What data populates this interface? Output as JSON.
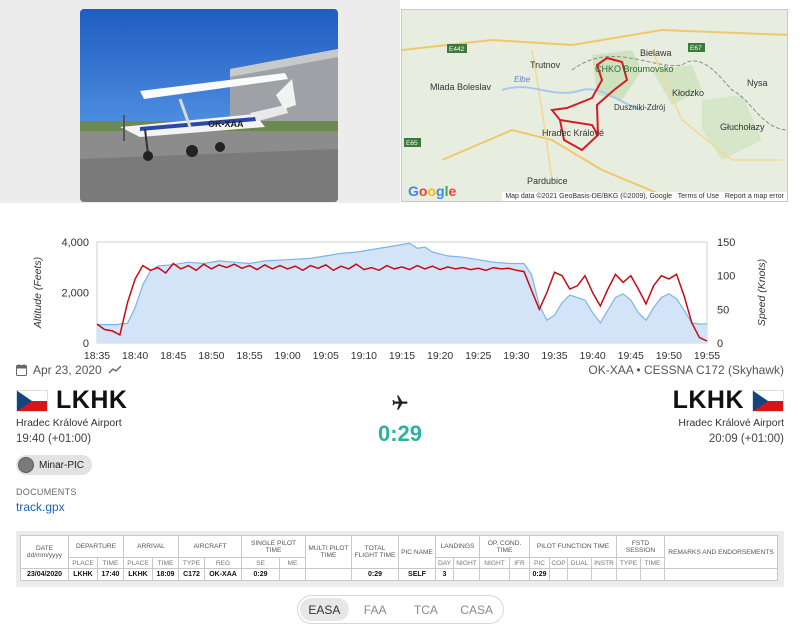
{
  "photo": {
    "registration_marking": "OK-XAA"
  },
  "map": {
    "places": [
      "Trutnov",
      "Mlada Boleslav",
      "Hradec Králové",
      "Pardubice",
      "Kłodzko",
      "Nysa",
      "Bielawa",
      "Głuchołazy",
      "Duszniki-Zdrój",
      "CHKO Broumovsko",
      "Elbe"
    ],
    "road_labels": [
      "E442",
      "E67",
      "E65"
    ],
    "attribution": "Map data ©2021 GeoBasis-DE/BKG (©2009), Google",
    "terms": "Terms of Use",
    "report": "Report a map error",
    "logo": "Google"
  },
  "chart_data": {
    "type": "line",
    "ylabel_left": "Altitude (Feets)",
    "ylabel_right": "Speed (Knots)",
    "y_left_ticks": [
      "4,000",
      "2,000",
      "0"
    ],
    "y_right_ticks": [
      "150",
      "100",
      "50",
      "0"
    ],
    "ylim_left": [
      0,
      4000
    ],
    "ylim_right": [
      0,
      150
    ],
    "x_ticks": [
      "18:35",
      "18:40",
      "18:45",
      "18:50",
      "18:55",
      "19:00",
      "19:05",
      "19:10",
      "19:15",
      "19:20",
      "19:25",
      "19:30",
      "19:35",
      "19:40",
      "19:45",
      "19:50",
      "19:55"
    ],
    "xlim_minutes": [
      0,
      80
    ],
    "series": [
      {
        "name": "",
        "axis": "left",
        "style": "area",
        "color": "#7cb3ea",
        "points": [
          [
            0,
            730
          ],
          [
            2.5,
            730
          ],
          [
            3,
            750
          ],
          [
            4,
            780
          ],
          [
            5,
            1400
          ],
          [
            6,
            2300
          ],
          [
            7,
            2850
          ],
          [
            8,
            3050
          ],
          [
            10,
            3100
          ],
          [
            12,
            3200
          ],
          [
            14,
            3150
          ],
          [
            16,
            3250
          ],
          [
            18,
            3200
          ],
          [
            20,
            3150
          ],
          [
            22,
            3250
          ],
          [
            25,
            3300
          ],
          [
            28,
            3350
          ],
          [
            30,
            3450
          ],
          [
            32,
            3550
          ],
          [
            34,
            3600
          ],
          [
            36,
            3700
          ],
          [
            37,
            3750
          ],
          [
            38,
            3800
          ],
          [
            40,
            3900
          ],
          [
            41,
            3950
          ],
          [
            42,
            3750
          ],
          [
            43,
            3800
          ],
          [
            44,
            3600
          ],
          [
            46,
            3450
          ],
          [
            48,
            3400
          ],
          [
            50,
            3300
          ],
          [
            52,
            3200
          ],
          [
            54,
            3150
          ],
          [
            56,
            3150
          ],
          [
            57,
            2700
          ],
          [
            58,
            1500
          ],
          [
            59,
            900
          ],
          [
            60,
            1100
          ],
          [
            61,
            1600
          ],
          [
            62,
            1900
          ],
          [
            64,
            1700
          ],
          [
            65,
            1200
          ],
          [
            66,
            800
          ],
          [
            67,
            1300
          ],
          [
            68,
            1800
          ],
          [
            69,
            1950
          ],
          [
            70,
            1700
          ],
          [
            71,
            1200
          ],
          [
            72,
            900
          ],
          [
            73,
            1400
          ],
          [
            74,
            1800
          ],
          [
            75,
            1950
          ],
          [
            76,
            1750
          ],
          [
            77,
            1300
          ],
          [
            78,
            800
          ],
          [
            79,
            750
          ],
          [
            80,
            760
          ]
        ]
      },
      {
        "name": "",
        "axis": "right",
        "style": "line",
        "color": "#c20d17",
        "points": [
          [
            0,
            28
          ],
          [
            1,
            20
          ],
          [
            2,
            18
          ],
          [
            3,
            12
          ],
          [
            4,
            60
          ],
          [
            5,
            95
          ],
          [
            6,
            115
          ],
          [
            7,
            108
          ],
          [
            8,
            112
          ],
          [
            9,
            104
          ],
          [
            10,
            118
          ],
          [
            11,
            110
          ],
          [
            12,
            115
          ],
          [
            13,
            108
          ],
          [
            14,
            117
          ],
          [
            15,
            110
          ],
          [
            16,
            116
          ],
          [
            17,
            112
          ],
          [
            18,
            117
          ],
          [
            19,
            111
          ],
          [
            20,
            115
          ],
          [
            21,
            109
          ],
          [
            22,
            116
          ],
          [
            23,
            110
          ],
          [
            24,
            115
          ],
          [
            25,
            110
          ],
          [
            26,
            114
          ],
          [
            27,
            108
          ],
          [
            28,
            115
          ],
          [
            29,
            111
          ],
          [
            30,
            116
          ],
          [
            31,
            108
          ],
          [
            32,
            114
          ],
          [
            33,
            110
          ],
          [
            34,
            117
          ],
          [
            35,
            109
          ],
          [
            36,
            112
          ],
          [
            37,
            108
          ],
          [
            38,
            115
          ],
          [
            39,
            110
          ],
          [
            40,
            113
          ],
          [
            41,
            109
          ],
          [
            42,
            115
          ],
          [
            43,
            110
          ],
          [
            44,
            114
          ],
          [
            45,
            109
          ],
          [
            46,
            113
          ],
          [
            47,
            110
          ],
          [
            48,
            112
          ],
          [
            49,
            109
          ],
          [
            50,
            111
          ],
          [
            51,
            108
          ],
          [
            52,
            112
          ],
          [
            53,
            110
          ],
          [
            54,
            111
          ],
          [
            55,
            108
          ],
          [
            56,
            106
          ],
          [
            57,
            78
          ],
          [
            58,
            50
          ],
          [
            59,
            75
          ],
          [
            60,
            105
          ],
          [
            61,
            100
          ],
          [
            62,
            80
          ],
          [
            63,
            85
          ],
          [
            64,
            100
          ],
          [
            65,
            75
          ],
          [
            66,
            55
          ],
          [
            67,
            80
          ],
          [
            68,
            102
          ],
          [
            69,
            90
          ],
          [
            70,
            100
          ],
          [
            71,
            80
          ],
          [
            72,
            58
          ],
          [
            73,
            85
          ],
          [
            74,
            100
          ],
          [
            75,
            95
          ],
          [
            76,
            102
          ],
          [
            77,
            70
          ],
          [
            78,
            30
          ],
          [
            79,
            8
          ],
          [
            80,
            3
          ]
        ]
      }
    ]
  },
  "summary": {
    "date": "Apr 23, 2020",
    "aircraft": "OK-XAA • CESSNA C172 (Skyhawk)"
  },
  "departure": {
    "code": "LKHK",
    "name": "Hradec Králové Airport",
    "time": "19:40 (+01:00)"
  },
  "arrival": {
    "code": "LKHK",
    "name": "Hradec Králové Airport",
    "time": "20:09 (+01:00)"
  },
  "flight": {
    "duration": "0:29"
  },
  "crew": [
    {
      "label": "Minar-PIC"
    }
  ],
  "documents": {
    "heading": "DOCUMENTS",
    "files": [
      "track.gpx"
    ]
  },
  "logbook": {
    "header_top": [
      "DATE",
      "DEPARTURE",
      "ARRIVAL",
      "AIRCRAFT",
      "SINGLE PILOT TIME",
      "MULTI PILOT TIME",
      "TOTAL FLIGHT TIME",
      "PIC NAME",
      "LANDINGS",
      "OP. COND. TIME",
      "PILOT FUNCTION TIME",
      "FSTD SESSION",
      "REMARKS AND ENDORSEMENTS"
    ],
    "header_sub": [
      "dd/mm/yyyy",
      "PLACE",
      "TIME",
      "PLACE",
      "TIME",
      "TYPE",
      "REG",
      "SE",
      "ME",
      "DAY",
      "NIGHT",
      "NIGHT",
      "IFR",
      "PIC",
      "COP",
      "DUAL",
      "INSTR",
      "TYPE",
      "TIME"
    ],
    "row": {
      "date": "23/04/2020",
      "dep_place": "LKHK",
      "dep_time": "17:40",
      "arr_place": "LKHK",
      "arr_time": "18:09",
      "type": "C172",
      "reg": "OK-XAA",
      "se": "0:29",
      "me": "",
      "multi": "",
      "total": "0:29",
      "pic_name": "SELF",
      "day": "3",
      "night_ldg": "",
      "night": "",
      "ifr": "",
      "pic": "0:29",
      "cop": "",
      "dual": "",
      "instr": "",
      "fstd_type": "",
      "fstd_time": "",
      "remarks": ""
    }
  },
  "tabs": [
    "EASA",
    "FAA",
    "TCA",
    "CASA"
  ],
  "active_tab": "EASA"
}
